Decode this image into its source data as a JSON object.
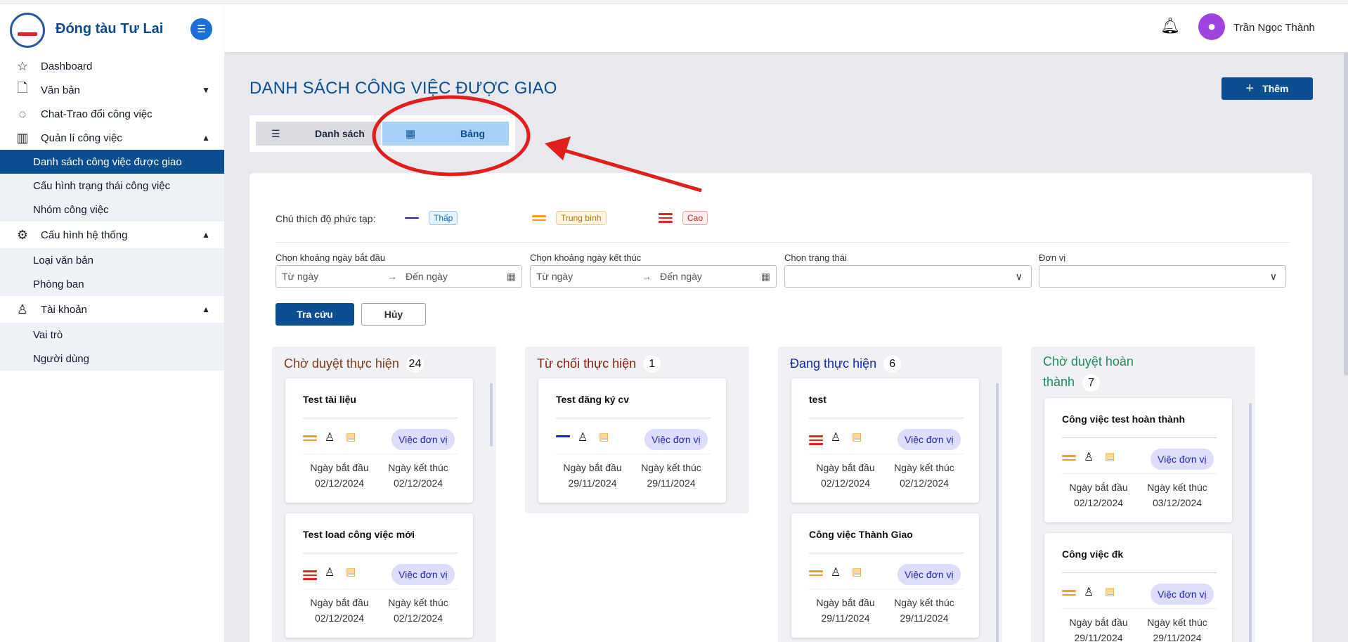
{
  "app": {
    "brand": "Đóng tàu Tư Lai"
  },
  "user": {
    "name": "Trần Ngọc Thành"
  },
  "sidebar": {
    "items": [
      {
        "label": "Dashboard",
        "icon": "star-icon"
      },
      {
        "label": "Văn bản",
        "icon": "document-icon"
      },
      {
        "label": "Chat-Trao đổi công việc",
        "icon": "chat-icon"
      },
      {
        "label": "Quản lí công việc",
        "icon": "board-icon"
      },
      {
        "label": "Danh sách công việc được giao"
      },
      {
        "label": "Cấu hình trạng thái công việc"
      },
      {
        "label": "Nhóm công việc"
      },
      {
        "label": "Cấu hình hệ thống",
        "icon": "gear-icon"
      },
      {
        "label": "Loại văn bản"
      },
      {
        "label": "Phòng ban"
      },
      {
        "label": "Tài khoản",
        "icon": "user-icon"
      },
      {
        "label": "Vai trò"
      },
      {
        "label": "Người dùng"
      }
    ]
  },
  "page": {
    "title": "DANH SÁCH CÔNG VIỆC ĐƯỢC GIAO",
    "add_label": "Thêm"
  },
  "views": {
    "list_label": "Danh sách",
    "table_label": "Bảng"
  },
  "legend": {
    "label": "Chú thích độ phức tạp:",
    "low": "Thấp",
    "medium": "Trung bình",
    "high": "Cao",
    "colors": {
      "low": "#1a1fc9",
      "medium": "#f0a020",
      "high": "#e2261c"
    }
  },
  "filters": {
    "start_label": "Chọn khoảng ngày bắt đầu",
    "end_label": "Chọn khoảng ngày kết thúc",
    "status_label": "Chọn trạng thái",
    "unit_label": "Đơn vị",
    "from_placeholder": "Từ ngày",
    "to_placeholder": "Đến ngày",
    "search_label": "Tra cứu",
    "cancel_label": "Hủy"
  },
  "columns": [
    {
      "title": "Chờ duyệt thực hiện",
      "count": "24",
      "color": "#7a3b1b",
      "cards": [
        {
          "title": "Test tài liệu",
          "complexity": "medium",
          "tag": "Việc đơn vị",
          "start_label": "Ngày bắt đầu",
          "start": "02/12/2024",
          "end_label": "Ngày kết thúc",
          "end": "02/12/2024"
        },
        {
          "title": "Test load công việc mới",
          "complexity": "high",
          "tag": "Việc đơn vị",
          "start_label": "Ngày bắt đầu",
          "start": "02/12/2024",
          "end_label": "Ngày kết thúc",
          "end": "02/12/2024"
        }
      ]
    },
    {
      "title": "Từ chối thực hiện",
      "count": "1",
      "color": "#8b1a10",
      "cards": [
        {
          "title": "Test đăng ký cv",
          "complexity": "low",
          "tag": "Việc đơn vị",
          "start_label": "Ngày bắt đầu",
          "start": "29/11/2024",
          "end_label": "Ngày kết thúc",
          "end": "29/11/2024"
        }
      ]
    },
    {
      "title": "Đang thực hiện",
      "count": "6",
      "color": "#1526a8",
      "cards": [
        {
          "title": "test",
          "complexity": "high",
          "tag": "Việc đơn vị",
          "start_label": "Ngày bắt đầu",
          "start": "02/12/2024",
          "end_label": "Ngày kết thúc",
          "end": "02/12/2024"
        },
        {
          "title": "Công việc Thành Giao",
          "complexity": "medium",
          "tag": "Việc đơn vị",
          "start_label": "Ngày bắt đầu",
          "start": "29/11/2024",
          "end_label": "Ngày kết thúc",
          "end": "29/11/2024"
        }
      ]
    },
    {
      "title_line1": "Chờ duyệt hoàn",
      "title_line2": "thành",
      "count": "7",
      "color": "#1f8a5a",
      "cards": [
        {
          "title": "Công việc test hoàn thành",
          "complexity": "medium",
          "tag": "Việc đơn vị",
          "start_label": "Ngày bắt đầu",
          "start": "02/12/2024",
          "end_label": "Ngày kết thúc",
          "end": "03/12/2024"
        },
        {
          "title": "Công việc đk",
          "complexity": "medium",
          "tag": "Việc đơn vị",
          "start_label": "Ngày bắt đầu",
          "start": "29/11/2024",
          "end_label": "Ngày kết thúc",
          "end": "29/11/2024"
        }
      ]
    }
  ]
}
